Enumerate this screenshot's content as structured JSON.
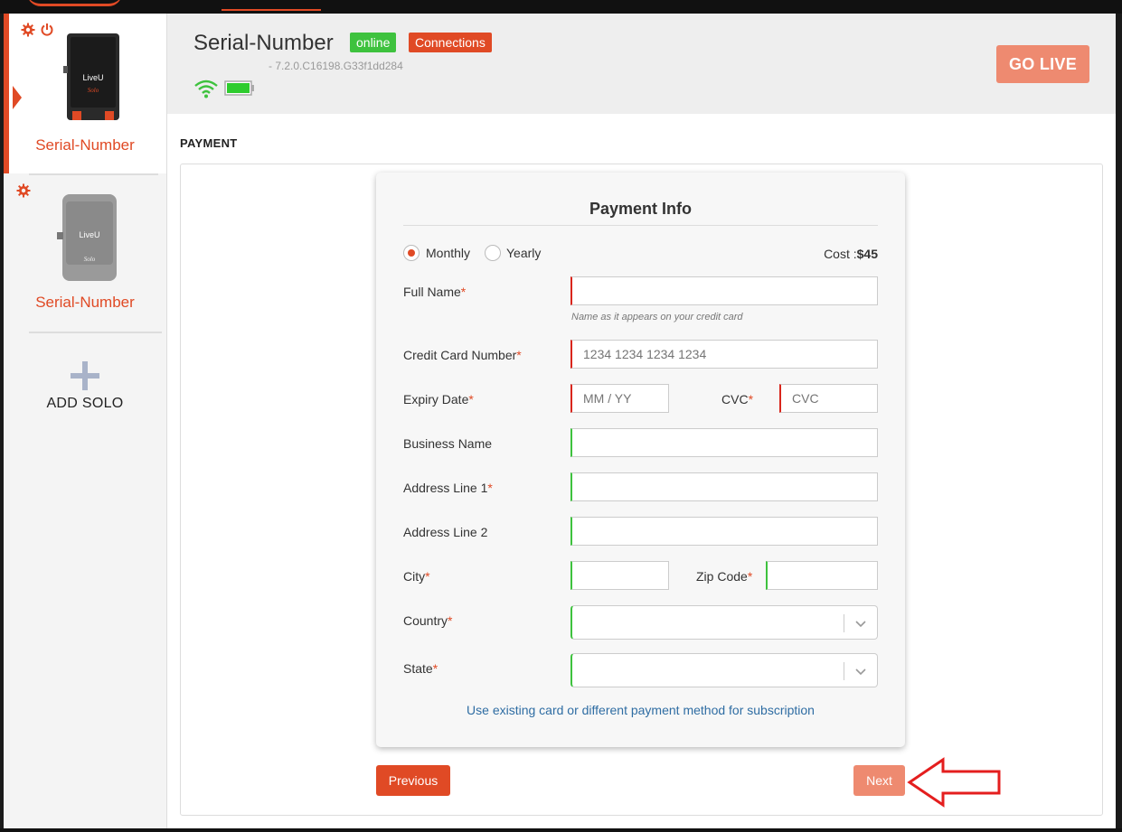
{
  "sidebar": {
    "devices": [
      {
        "label": "Serial-Number",
        "status": "active"
      },
      {
        "label": "Serial-Number",
        "status": "inactive"
      }
    ],
    "device_brand": "LiveU",
    "device_model": "Solo",
    "add_label": "ADD SOLO"
  },
  "header": {
    "device_name": "Serial-Number",
    "online_badge": "online",
    "connections_badge": "Connections",
    "version": "- 7.2.0.C16198.G33f1dd284",
    "go_live_label": "GO LIVE"
  },
  "main": {
    "section_title": "PAYMENT",
    "card_title": "Payment Info",
    "plan": {
      "monthly_label": "Monthly",
      "yearly_label": "Yearly",
      "selected": "Monthly",
      "cost_label": "Cost :",
      "cost_value": "$45"
    },
    "fields": {
      "full_name_label": "Full Name",
      "full_name_hint": "Name as it appears on your credit card",
      "card_number_label": "Credit Card Number",
      "card_number_placeholder": "1234 1234 1234 1234",
      "expiry_label": "Expiry Date",
      "expiry_placeholder": "MM / YY",
      "cvc_label": "CVC",
      "cvc_placeholder": "CVC",
      "business_label": "Business Name",
      "address1_label": "Address Line 1",
      "address2_label": "Address Line 2",
      "city_label": "City",
      "zip_label": "Zip Code",
      "country_label": "Country",
      "state_label": "State",
      "required_mark": "*"
    },
    "alt_payment_link": "Use existing card or different payment method for subscription",
    "previous_label": "Previous",
    "next_label": "Next"
  },
  "colors": {
    "accent": "#e04a25",
    "accent_light": "#ee8a70",
    "online_green": "#3ec23e",
    "error_red": "#d9261c",
    "link_blue": "#2f6da3"
  }
}
